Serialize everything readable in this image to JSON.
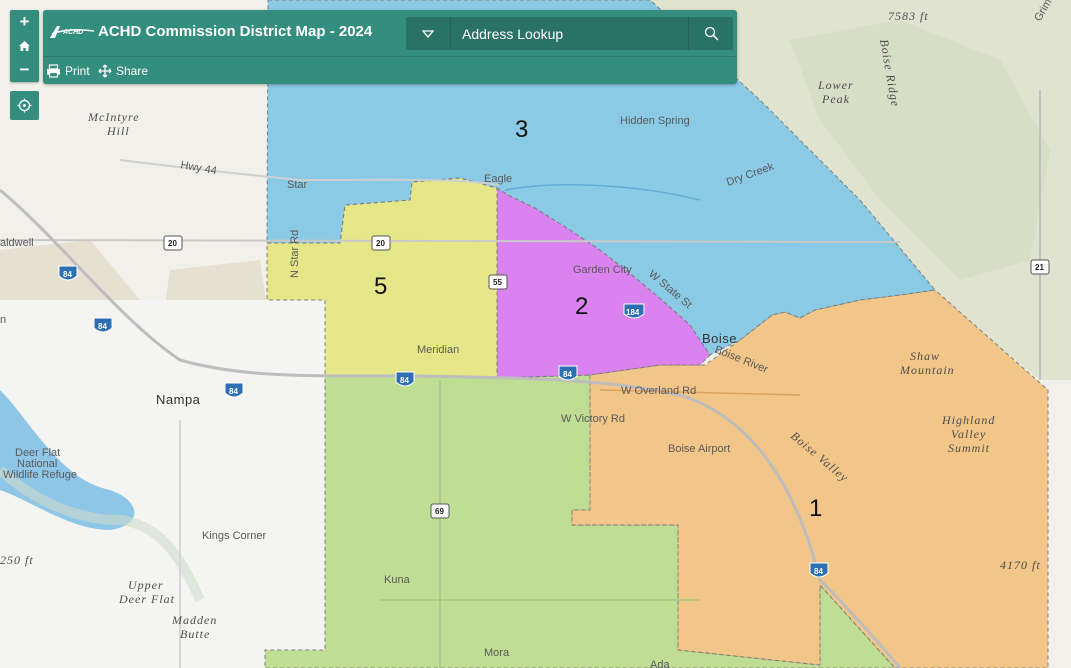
{
  "app": {
    "title": "ACHD Commission District Map - 2024",
    "logo_text": "ACHD",
    "search_placeholder": "Address Lookup",
    "tools": {
      "print": "Print",
      "share": "Share"
    },
    "zoom": {
      "in": "+",
      "out": "−"
    }
  },
  "districts": [
    {
      "id": "1",
      "label": "1",
      "color": "#f2bd77"
    },
    {
      "id": "2",
      "label": "2",
      "color": "#d66ff0"
    },
    {
      "id": "3",
      "label": "3",
      "color": "#78c3e4"
    },
    {
      "id": "4",
      "label": "",
      "color": "#b6d984"
    },
    {
      "id": "5",
      "label": "5",
      "color": "#e2e475"
    }
  ],
  "places": {
    "star": "Star",
    "eagle": "Eagle",
    "hidden_spring": "Hidden Spring",
    "garden_city": "Garden City",
    "meridian": "Meridian",
    "boise": "Boise",
    "nampa": "Nampa",
    "kuna": "Kuna",
    "mora": "Mora",
    "ada": "Ada",
    "caldwell": "aldwell",
    "kings_corner": "Kings Corner",
    "boise_airport": "Boise Airport",
    "deer_flat_1": "Deer Flat",
    "deer_flat_2": "National",
    "deer_flat_3": "Wildlife Refuge",
    "n_edge": "n"
  },
  "roads": {
    "hwy44": "Hwy 44",
    "n_star_rd": "N Star Rd",
    "w_state_st": "W State St",
    "w_overland": "W Overland Rd",
    "w_victory": "W Victory Rd",
    "boise_river": "Boise River",
    "dry_creek": "Dry Creek",
    "grimes": "Grimes"
  },
  "terrain": {
    "mcintyre_1": "McIntyre",
    "mcintyre_2": "Hill",
    "lower_peak_1": "Lower",
    "lower_peak_2": "Peak",
    "boise_ridge": "Boise Ridge",
    "shaw_1": "Shaw",
    "shaw_2": "Mountain",
    "highland_1": "Highland",
    "highland_2": "Valley",
    "highland_3": "Summit",
    "boise_valley": "Boise Valley",
    "upper_deer_1": "Upper",
    "upper_deer_2": "Deer Flat",
    "madden_1": "Madden",
    "madden_2": "Butte"
  },
  "elevations": {
    "e7583": "7583 ft",
    "e4170": "4170 ft",
    "e250": "250 ft"
  },
  "shields": {
    "us20a": "20",
    "us20b": "20",
    "i84a": "84",
    "i84b": "84",
    "i84c": "84",
    "i84d": "84",
    "i84e": "84",
    "i84f": "84",
    "i184": "184",
    "s55": "55",
    "s69": "69",
    "s21": "21"
  }
}
